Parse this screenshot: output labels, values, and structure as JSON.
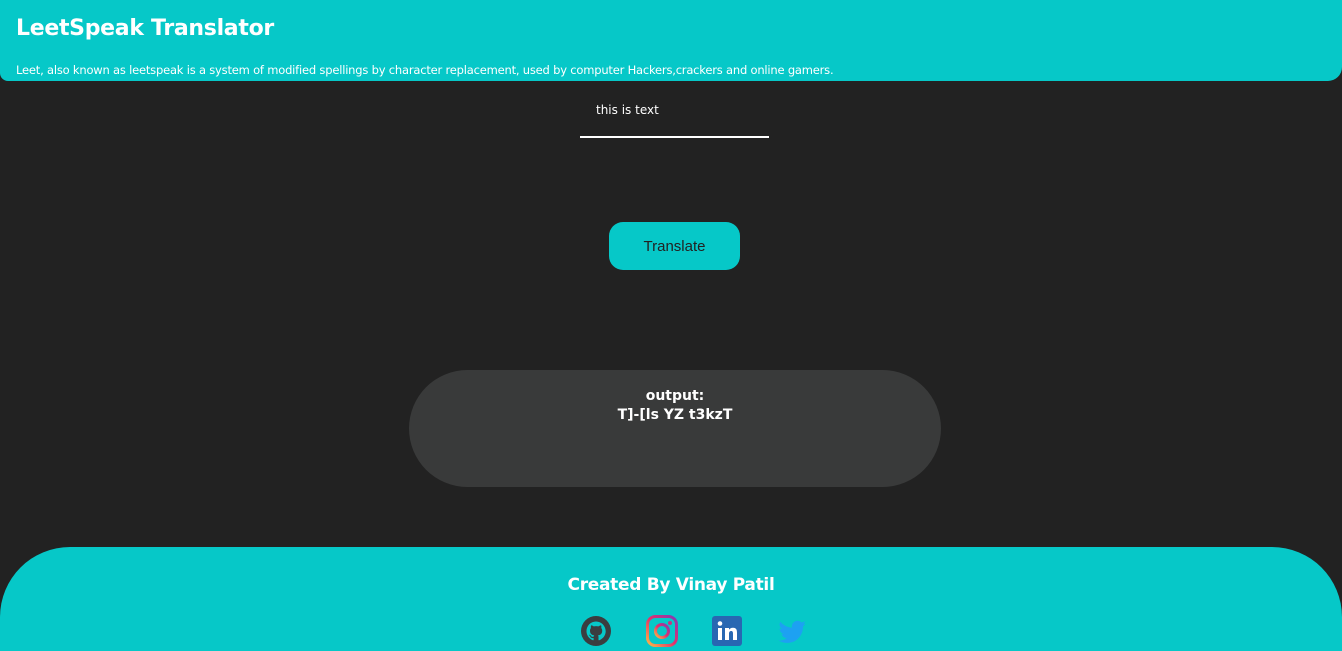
{
  "header": {
    "title": "LeetSpeak Translator",
    "description": "Leet, also known as leetspeak is a system of modified spellings by character replacement, used by computer Hackers,crackers and online gamers."
  },
  "input": {
    "value": "this is text"
  },
  "translate_button": {
    "label": "Translate"
  },
  "output": {
    "label": "output:",
    "text": "T]-[ls YZ t3kzT"
  },
  "footer": {
    "credit": "Created By Vinay Patil",
    "social_icons": [
      "github-icon",
      "instagram-icon",
      "linkedin-icon",
      "twitter-icon"
    ]
  },
  "colors": {
    "accent": "#06c8c8",
    "background": "#222222",
    "output_box": "#393a3a",
    "text": "#ffffff"
  }
}
